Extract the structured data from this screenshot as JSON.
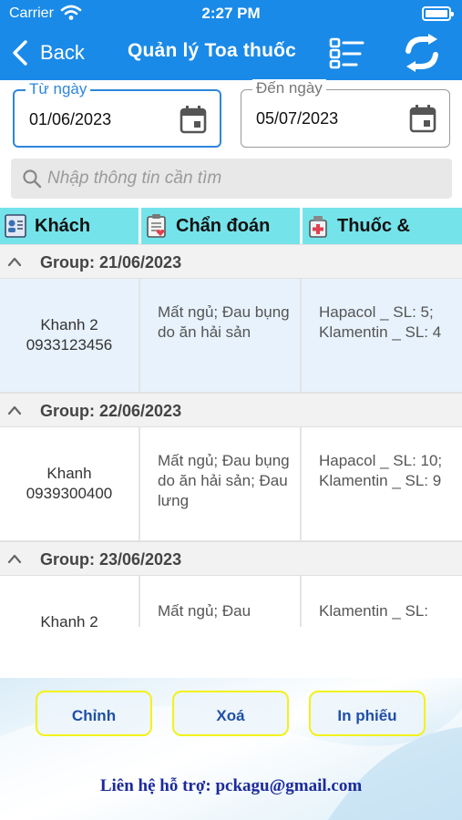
{
  "status_bar": {
    "carrier": "Carrier",
    "time": "2:27 PM"
  },
  "nav": {
    "back_label": "Back",
    "title": "Quản lý Toa thuốc",
    "icons": [
      "chevron-left-icon",
      "list-icon",
      "refresh-icon"
    ]
  },
  "filters": {
    "from": {
      "label": "Từ ngày",
      "value": "01/06/2023"
    },
    "to": {
      "label": "Đến ngày",
      "value": "05/07/2023"
    }
  },
  "search": {
    "placeholder": "Nhập thông tin cần tìm"
  },
  "columns": [
    {
      "label": "Khách",
      "icon": "customer-card-icon"
    },
    {
      "label": "Chẩn đoán",
      "icon": "clipboard-icon"
    },
    {
      "label": "Thuốc &",
      "icon": "medicine-icon"
    }
  ],
  "groups": [
    {
      "title": "Group: 21/06/2023",
      "rows": [
        {
          "name": "Khanh 2",
          "phone": "0933123456",
          "diagnosis": "Mất ngủ; Đau bụng do ăn hải sản",
          "medicine": "Hapacol _ SL: 5; Klamentin _ SL: 4",
          "selected": true
        }
      ]
    },
    {
      "title": "Group: 22/06/2023",
      "rows": [
        {
          "name": "Khanh",
          "phone": "0939300400",
          "diagnosis": "Mất ngủ; Đau bụng do ăn hải sản; Đau lưng",
          "medicine": "Hapacol _ SL: 10; Klamentin _ SL: 9",
          "selected": false
        }
      ]
    },
    {
      "title": "Group: 23/06/2023",
      "rows": [
        {
          "name": "Khanh 2",
          "phone": "",
          "diagnosis": "Mất ngủ; Đau",
          "medicine": "Klamentin _ SL:",
          "selected": false
        }
      ]
    }
  ],
  "buttons": {
    "edit": "Chỉnh",
    "delete": "Xoá",
    "print": "In phiếu"
  },
  "support": "Liên hệ hỗ trợ: pckagu@gmail.com",
  "colors": {
    "nav_bar": "#1a8ae8",
    "column_header": "#75e3ea",
    "selected_row": "#e7f2fc",
    "button_border": "#f2f21a",
    "button_text": "#1f4fa8",
    "support_text": "#1b2a9c"
  }
}
